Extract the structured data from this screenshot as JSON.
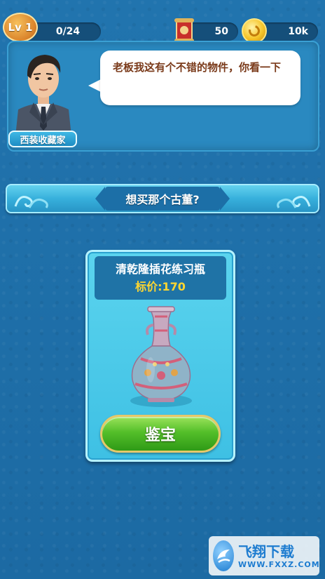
{
  "hud": {
    "level_label": "Lv 1",
    "progress": "0/24",
    "scrolls": "50",
    "coins": "10k"
  },
  "dialog": {
    "character_name": "西装收藏家",
    "speech": "老板我这有个不错的物件，你看一下"
  },
  "banner": {
    "question": "想买那个古董?"
  },
  "item": {
    "name": "清乾隆插花练习瓶",
    "price_label": "标价:170",
    "appraise_button": "鉴宝"
  },
  "watermark": {
    "brand": "飞翔下载",
    "url": "WWW.FXXZ.COM"
  },
  "colors": {
    "background": "#1f6fa8",
    "price": "#ffd630",
    "button": "#54bf2a",
    "speech_text": "#7a3a1a"
  }
}
